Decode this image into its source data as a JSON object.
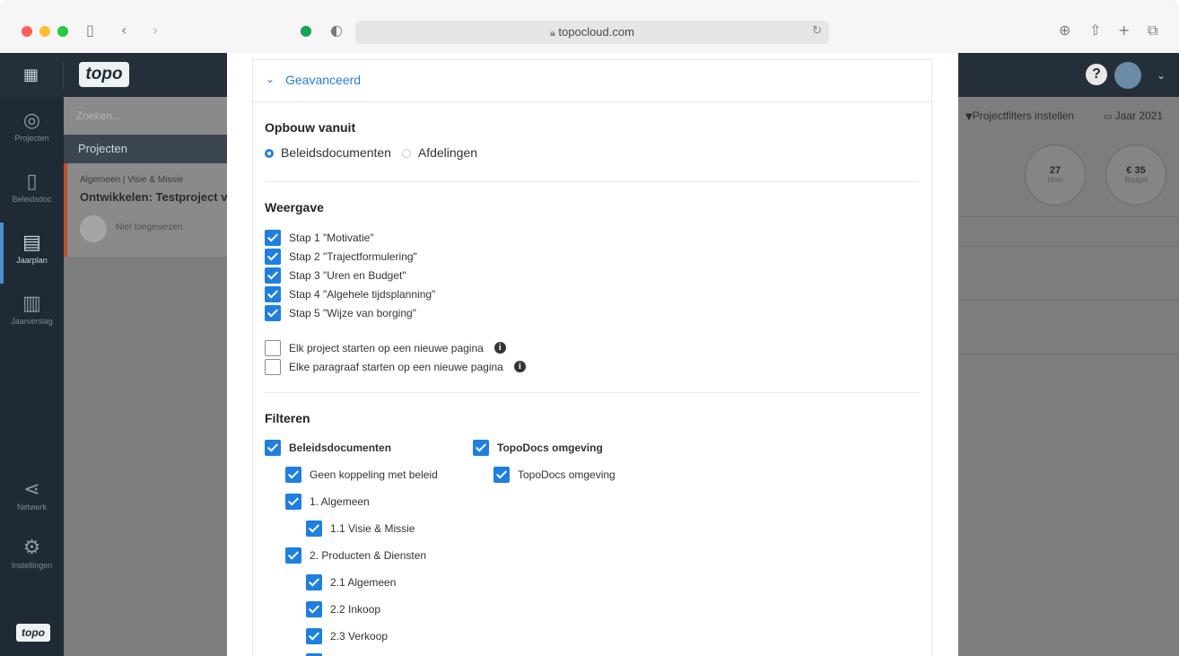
{
  "browser": {
    "url": "topocloud.com",
    "traffic_colors": {
      "close": "#ff5f57",
      "minimize": "#febc2e",
      "maximize": "#28c840"
    }
  },
  "app": {
    "logo_text": "topo",
    "search_placeholder": "Zoeken...",
    "nav": [
      {
        "label": "Projecten",
        "icon": "target-icon"
      },
      {
        "label": "Beleidsdoc",
        "icon": "book-icon"
      },
      {
        "label": "Jaarplan",
        "icon": "document-icon"
      },
      {
        "label": "Jaarverslag",
        "icon": "chart-document-icon"
      },
      {
        "label": "Netwerk",
        "icon": "share-icon"
      },
      {
        "label": "Instellingen",
        "icon": "gear-icon"
      }
    ],
    "projects_header": "Projecten",
    "project_card": {
      "crumb": "Algemeen | Visie & Missie",
      "title": "Ontwikkelen: Testproject v",
      "assignee": "Niet toegewezen",
      "accent_color": "#c0502a"
    },
    "toolbar": {
      "filters_label": "Projectfilters instellen",
      "year_label": "Jaar 2021"
    },
    "stats": [
      {
        "value": "27",
        "label": "Uren"
      },
      {
        "value": "€ 35",
        "label": "Budget"
      }
    ]
  },
  "modal": {
    "advanced_label": "Geavanceerd",
    "accent_color": "#1f7fe0",
    "build_from": {
      "title": "Opbouw vanuit",
      "options": [
        {
          "label": "Beleidsdocumenten",
          "selected": true
        },
        {
          "label": "Afdelingen",
          "selected": false
        }
      ]
    },
    "display": {
      "title": "Weergave",
      "steps": [
        {
          "label": "Stap 1 \"Motivatie\"",
          "checked": true
        },
        {
          "label": "Stap 2 \"Trajectformulering\"",
          "checked": true
        },
        {
          "label": "Stap 3 \"Uren en Budget\"",
          "checked": true
        },
        {
          "label": "Stap 4 \"Algehele tijdsplanning\"",
          "checked": true
        },
        {
          "label": "Stap 5 \"Wijze van borging\"",
          "checked": true
        }
      ],
      "page_options": [
        {
          "label": "Elk project starten op een nieuwe pagina",
          "checked": false
        },
        {
          "label": "Elke paragraaf starten op een nieuwe pagina",
          "checked": false
        }
      ]
    },
    "filter": {
      "title": "Filteren",
      "policy_docs": [
        {
          "label": "Beleidsdocumenten",
          "checked": true
        },
        {
          "label": "Geen koppeling met beleid",
          "checked": true
        },
        {
          "label": "1. Algemeen",
          "checked": true
        },
        {
          "label": "1.1 Visie & Missie",
          "checked": true
        },
        {
          "label": "2. Producten & Diensten",
          "checked": true
        },
        {
          "label": "2.1 Algemeen",
          "checked": true
        },
        {
          "label": "2.2 Inkoop",
          "checked": true
        },
        {
          "label": "2.3 Verkoop",
          "checked": true
        }
      ],
      "environment": [
        {
          "label": "TopoDocs omgeving",
          "checked": true
        },
        {
          "label": "TopoDocs omgeving",
          "checked": true
        }
      ]
    }
  }
}
